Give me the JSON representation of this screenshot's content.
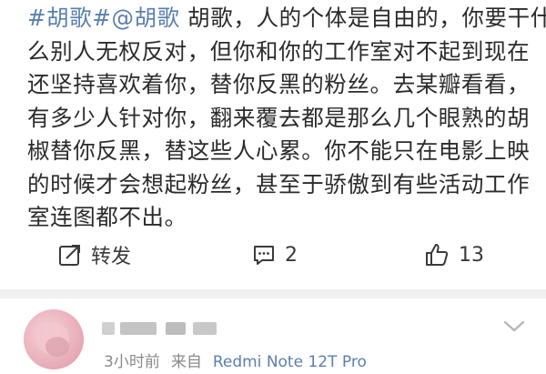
{
  "post": {
    "hashtag1": "#胡歌#",
    "hashtag2": "@胡歌",
    "line1_rest": " 胡歌，人的个体是自由的，你要干什",
    "line2": "么别人无权反对，但你和你的工作室对不起到现在",
    "line3": "还坚持喜欢着你，替你反黑的粉丝。去某瓣看看，",
    "line4": "有多少人针对你，翻来覆去都是那么几个眼熟的胡",
    "line5": "椒替你反黑，替这些人心累。你不能只在电影上映",
    "line6": "的时候才会想起粉丝，甚至于骄傲到有些活动工作",
    "line7": "室连图都不出。"
  },
  "actions": {
    "repost_label": "转发",
    "comment_count": "2",
    "like_count": "13"
  },
  "comment": {
    "time": "3小时前",
    "source_prefix": "来自",
    "device": "Redmi Note 12T Pro"
  },
  "icons": {
    "repost": "share-edit-icon",
    "comment": "comment-bubble-icon",
    "like": "thumbs-up-icon",
    "expand": "chevron-down-icon"
  },
  "colors": {
    "link": "#5b7fb0",
    "text": "#2b2b2b",
    "meta": "#8a8a8a",
    "divider": "#f1f1f1"
  }
}
